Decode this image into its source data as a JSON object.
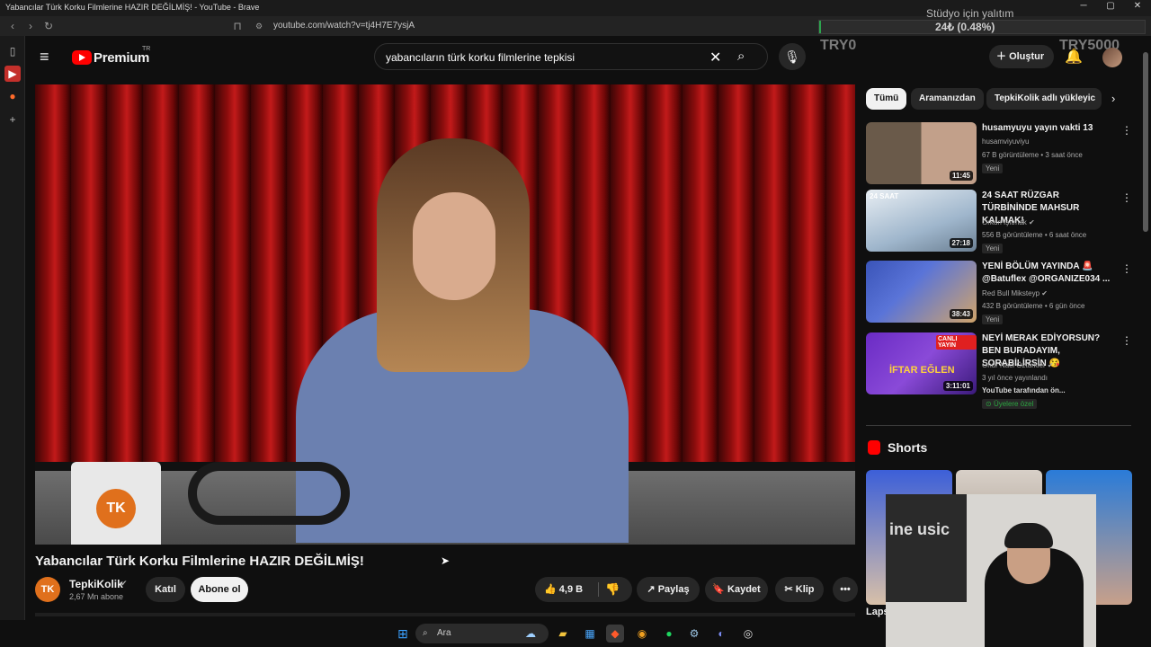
{
  "window": {
    "title": "Yabancılar Türk Korku Filmlerine HAZIR DEĞİLMİŞ! - YouTube - Brave",
    "url": "youtube.com/watch?v=tj4H7E7ysjA",
    "minimize_icon": "minimize-icon",
    "maximize_icon": "maximize-icon",
    "close_icon": "close-icon"
  },
  "stream_overlay": {
    "title": "Stüdyo için yalıtım",
    "value": "24₺ (0.48%)",
    "progress_fraction": 0.0048,
    "left_label": "TRY0",
    "right_label": "TRY5000"
  },
  "header": {
    "brand": "Premium",
    "region": "TR",
    "search_query": "yabancıların türk korku filmlerine tepkisi",
    "create_label": "Oluştur"
  },
  "video": {
    "title": "Yabancılar Türk Korku Filmlerine HAZIR DEĞİLMİŞ!",
    "channel": "TepkiKolik",
    "channel_initials": "TK",
    "subscribers": "2,67 Mn abone",
    "join_label": "Katıl",
    "subscribe_label": "Abone ol",
    "likes": "4,9 B",
    "share_label": "Paylaş",
    "save_label": "Kaydet",
    "clip_label": "Klip",
    "more_label": "•••",
    "mug_logo": "TK"
  },
  "chips": [
    "Tümü",
    "Aramanızdan",
    "TepkiKolik adlı yükleyic"
  ],
  "recommendations": [
    {
      "title": "husamyuyu yayın vakti 13",
      "channel": "husamviyuviyu",
      "stats": "67 B görüntüleme • 3 saat önce",
      "badge": "Yeni",
      "duration": "11:45",
      "colors": [
        "#6a5a4a",
        "#c2a08a"
      ]
    },
    {
      "title": "24 SAAT RÜZGAR TÜRBİNİNDE MAHSUR KALMAK!",
      "channel": "Orkun Işıtmak",
      "stats": "556 B görüntüleme • 6 saat önce",
      "badge": "Yeni",
      "duration": "27:18",
      "thumb_label": "24 SAAT",
      "colors": [
        "#9fb6cc",
        "#e8eef3"
      ]
    },
    {
      "title": "YENİ BÖLÜM YAYINDA 🚨 @Batuflex @ORGANIZE034 ...",
      "channel": "Red Bull Miksteyp",
      "stats": "432 B görüntüleme • 6 gün önce",
      "badge": "Yeni",
      "duration": "38:43",
      "colors": [
        "#3a54b8",
        "#d0a46a"
      ]
    },
    {
      "title": "NEYİ MERAK EDİYORSUN? BEN BURADAYIM, SORABİLİRSİN 😘",
      "channel": "Onur Naci Öztürkler",
      "stats": "3 yıl önce yayınlandı",
      "extra": "YouTube tarafından ön...",
      "badge": "Üyelere özel",
      "duration": "3:11:01",
      "thumb_label": "İFTAR EĞLEN",
      "thumb_badge": "CANLI YAYIN",
      "colors": [
        "#6a2bc4",
        "#e0b53c"
      ]
    }
  ],
  "shorts": {
    "title": "Shorts",
    "caption": "Laps",
    "thumb_colors": [
      "#3c5fd8",
      "#d8d0c8",
      "#2a7bd8"
    ]
  },
  "webcam": {
    "screen_text": "ine usic"
  },
  "taskbar": {
    "search_placeholder": "Ara",
    "icons": [
      "windows-start-icon",
      "weather-icon",
      "file-explorer-icon",
      "store-icon",
      "brave-icon",
      "browser-icon",
      "spotify-icon",
      "steam-icon",
      "discord-icon",
      "obs-icon"
    ]
  },
  "colors": {
    "accent_red": "#ff0000",
    "background": "#0f0f0f",
    "member_green": "#2ba640"
  }
}
